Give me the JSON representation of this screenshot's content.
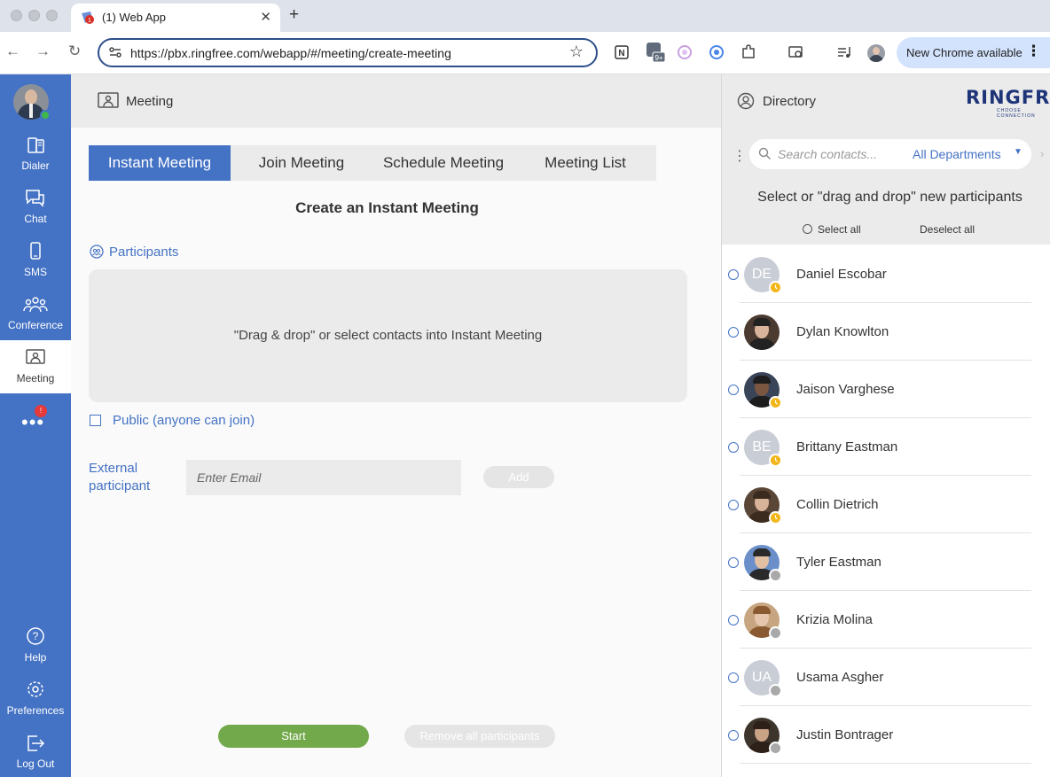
{
  "browser": {
    "tab_title": "(1) Web App",
    "url": "https://pbx.ringfree.com/webapp/#/meeting/create-meeting",
    "update_label": "New Chrome available",
    "update_menu": "⋮",
    "new_tab": "+",
    "close_tab": "✕",
    "back": "←",
    "forward": "→",
    "reload": "↻",
    "star": "☆",
    "ext_badge": "9+"
  },
  "sidebar": {
    "items": [
      {
        "label": "Dialer"
      },
      {
        "label": "Chat"
      },
      {
        "label": "SMS"
      },
      {
        "label": "Conference"
      },
      {
        "label": "Meeting"
      }
    ],
    "more": "•••",
    "more_badge": "!",
    "bottom": [
      {
        "label": "Help"
      },
      {
        "label": "Preferences"
      },
      {
        "label": "Log Out"
      }
    ]
  },
  "main": {
    "header_title": "Meeting",
    "tabs": [
      {
        "label": "Instant Meeting"
      },
      {
        "label": "Join Meeting"
      },
      {
        "label": "Schedule Meeting"
      },
      {
        "label": "Meeting List"
      }
    ],
    "create_title": "Create an Instant Meeting",
    "participants_label": "Participants",
    "drop_hint": "\"Drag & drop\" or select contacts into Instant Meeting",
    "public_label": "Public (anyone can join)",
    "external_label": "External participant",
    "email_placeholder": "Enter Email",
    "add_label": "Add",
    "start_label": "Start",
    "remove_label": "Remove all participants"
  },
  "directory": {
    "title": "Directory",
    "logo": "RINGFREE",
    "logo_sub": "CHOOSE CONNECTION",
    "search_placeholder": "Search contacts...",
    "department": "All Departments",
    "hint": "Select or \"drag and drop\" new participants",
    "select_all": "Select all",
    "deselect_all": "Deselect all",
    "contacts": [
      {
        "name": "Daniel Escobar",
        "initials": "DE",
        "status": "away"
      },
      {
        "name": "Dylan Knowlton",
        "initials": "",
        "status": "none"
      },
      {
        "name": "Jaison Varghese",
        "initials": "",
        "status": "away"
      },
      {
        "name": "Brittany Eastman",
        "initials": "BE",
        "status": "away"
      },
      {
        "name": "Collin Dietrich",
        "initials": "",
        "status": "away"
      },
      {
        "name": "Tyler Eastman",
        "initials": "",
        "status": "offline"
      },
      {
        "name": "Krizia Molina",
        "initials": "",
        "status": "offline"
      },
      {
        "name": "Usama Asgher",
        "initials": "UA",
        "status": "offline"
      },
      {
        "name": "Justin Bontrager",
        "initials": "",
        "status": "offline"
      }
    ]
  },
  "colors": {
    "accent": "#4472c4",
    "start": "#72a94a",
    "away": "#f2b619",
    "offline": "#a9a9a9",
    "online": "#3fb74c"
  }
}
